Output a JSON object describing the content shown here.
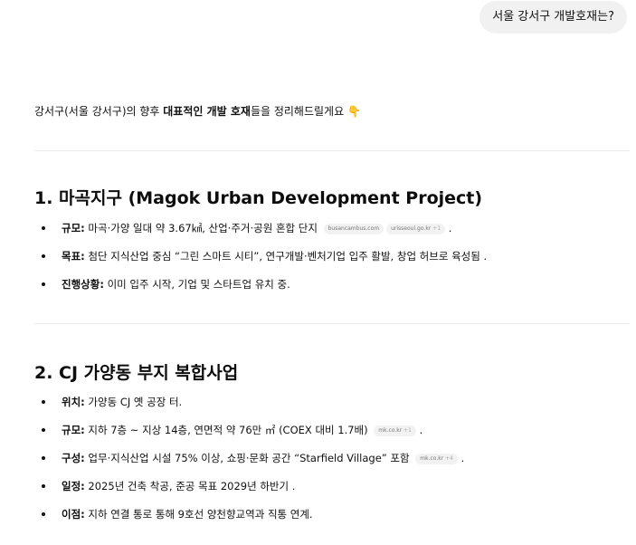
{
  "user_message": "서울 강서구 개발호재는?",
  "intro": {
    "prefix": "강서구(서울 강서구)의 향후 ",
    "bold1": "대표적인 개발 호재",
    "suffix": "들을 정리해드릴게요",
    "emoji": "👇"
  },
  "sections": [
    {
      "title": "1. 마곡지구 (Magok Urban Development Project)",
      "items": [
        {
          "label": "규모:",
          "text": " 마곡·가양 일대 약 3.67㎢, 산업·주거·공원 혼합 단지",
          "chips": [
            {
              "source": "busancambus.com",
              "more": ""
            },
            {
              "source": "urisseoul.go.kr",
              "more": "+1"
            }
          ],
          "tail": " ."
        },
        {
          "label": "목표:",
          "text": " 첨단 지식산업 중심 “그린 스마트 시티”, 연구개발·벤처기업 입주 활발, 창업 허브로 육성됨 .",
          "chips": [],
          "tail": ""
        },
        {
          "label": "진행상황:",
          "text": " 이미 입주 시작, 기업 및 스타트업 유치 중.",
          "chips": [],
          "tail": ""
        }
      ]
    },
    {
      "title": "2. CJ 가양동 부지 복합사업",
      "items": [
        {
          "label": "위치:",
          "text": " 가양동 CJ 옛 공장 터.",
          "chips": [],
          "tail": ""
        },
        {
          "label": "규모:",
          "text": " 지하 7층 ~ 지상 14층, 연면적 약 76만 ㎡ (COEX 대비 1.7배)",
          "chips": [
            {
              "source": "mk.co.kr",
              "more": "+1"
            }
          ],
          "tail": " ."
        },
        {
          "label": "구성:",
          "text": " 업무·지식산업 시설 75% 이상, 쇼핑·문화 공간 “Starfield Village” 포함",
          "chips": [
            {
              "source": "mk.co.kr",
              "more": "+4"
            }
          ],
          "tail": " ."
        },
        {
          "label": "일정:",
          "text": " 2025년 건축 착공, 준공 목표 2029년 하반기 .",
          "chips": [],
          "tail": ""
        },
        {
          "label": "이점:",
          "text": " 지하 연결 통로 통해 9호선 양천향교역과 직통 연계.",
          "chips": [],
          "tail": ""
        }
      ]
    }
  ]
}
